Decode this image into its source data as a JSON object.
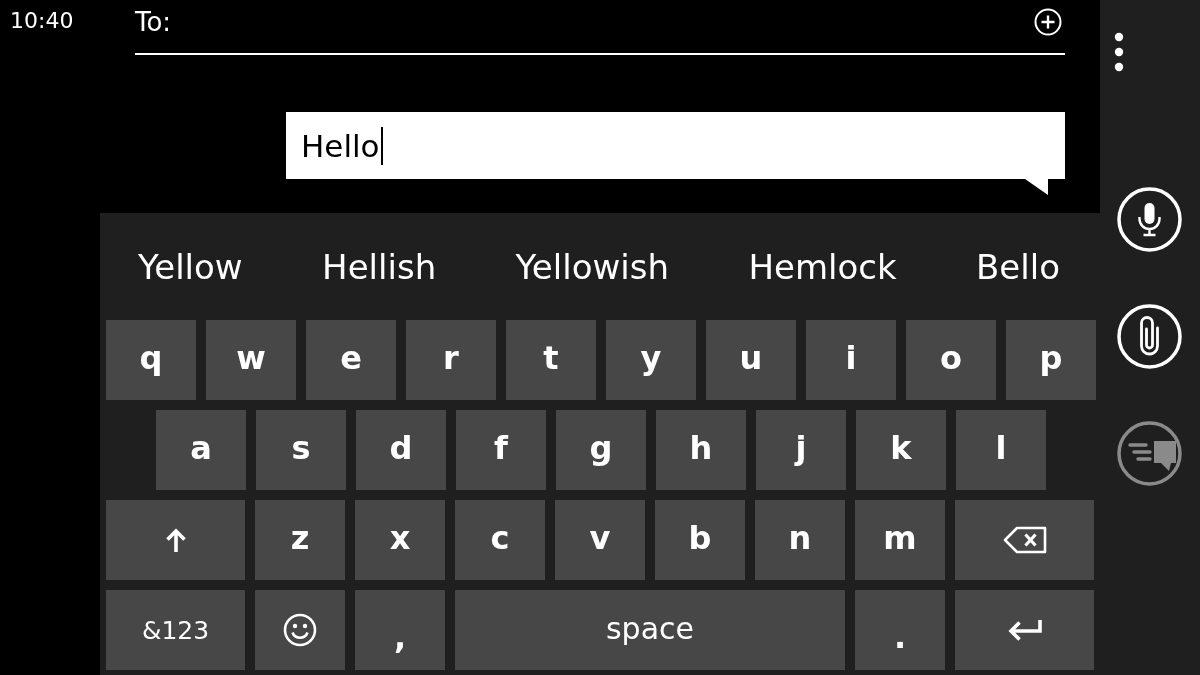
{
  "status_bar": {
    "time": "10:40"
  },
  "recipient": {
    "label": "To:"
  },
  "message": {
    "value": "Hello"
  },
  "suggestions": [
    "Yellow",
    "Hellish",
    "Yellowish",
    "Hemlock",
    "Bello"
  ],
  "keyboard": {
    "rows": [
      {
        "keys": [
          {
            "kind": "letter",
            "label": "q"
          },
          {
            "kind": "letter",
            "label": "w"
          },
          {
            "kind": "letter",
            "label": "e"
          },
          {
            "kind": "letter",
            "label": "r"
          },
          {
            "kind": "letter",
            "label": "t"
          },
          {
            "kind": "letter",
            "label": "y"
          },
          {
            "kind": "letter",
            "label": "u"
          },
          {
            "kind": "letter",
            "label": "i"
          },
          {
            "kind": "letter",
            "label": "o"
          },
          {
            "kind": "letter",
            "label": "p"
          }
        ]
      },
      {
        "keys": [
          {
            "kind": "letter",
            "label": "a"
          },
          {
            "kind": "letter",
            "label": "s"
          },
          {
            "kind": "letter",
            "label": "d"
          },
          {
            "kind": "letter",
            "label": "f"
          },
          {
            "kind": "letter",
            "label": "g"
          },
          {
            "kind": "letter",
            "label": "h"
          },
          {
            "kind": "letter",
            "label": "j"
          },
          {
            "kind": "letter",
            "label": "k"
          },
          {
            "kind": "letter",
            "label": "l"
          }
        ]
      },
      {
        "keys": [
          {
            "kind": "shift"
          },
          {
            "kind": "letter",
            "label": "z"
          },
          {
            "kind": "letter",
            "label": "x"
          },
          {
            "kind": "letter",
            "label": "c"
          },
          {
            "kind": "letter",
            "label": "v"
          },
          {
            "kind": "letter",
            "label": "b"
          },
          {
            "kind": "letter",
            "label": "n"
          },
          {
            "kind": "letter",
            "label": "m"
          },
          {
            "kind": "backspace"
          }
        ]
      },
      {
        "keys": [
          {
            "kind": "symbols",
            "label": "&123"
          },
          {
            "kind": "emoji"
          },
          {
            "kind": "punct",
            "label": ","
          },
          {
            "kind": "space",
            "label": "space"
          },
          {
            "kind": "punct",
            "label": "."
          },
          {
            "kind": "enter"
          }
        ]
      }
    ]
  },
  "app_bar": {
    "buttons": [
      {
        "kind": "voice",
        "disabled": false
      },
      {
        "kind": "attach",
        "disabled": false
      },
      {
        "kind": "send",
        "disabled": true
      }
    ]
  }
}
